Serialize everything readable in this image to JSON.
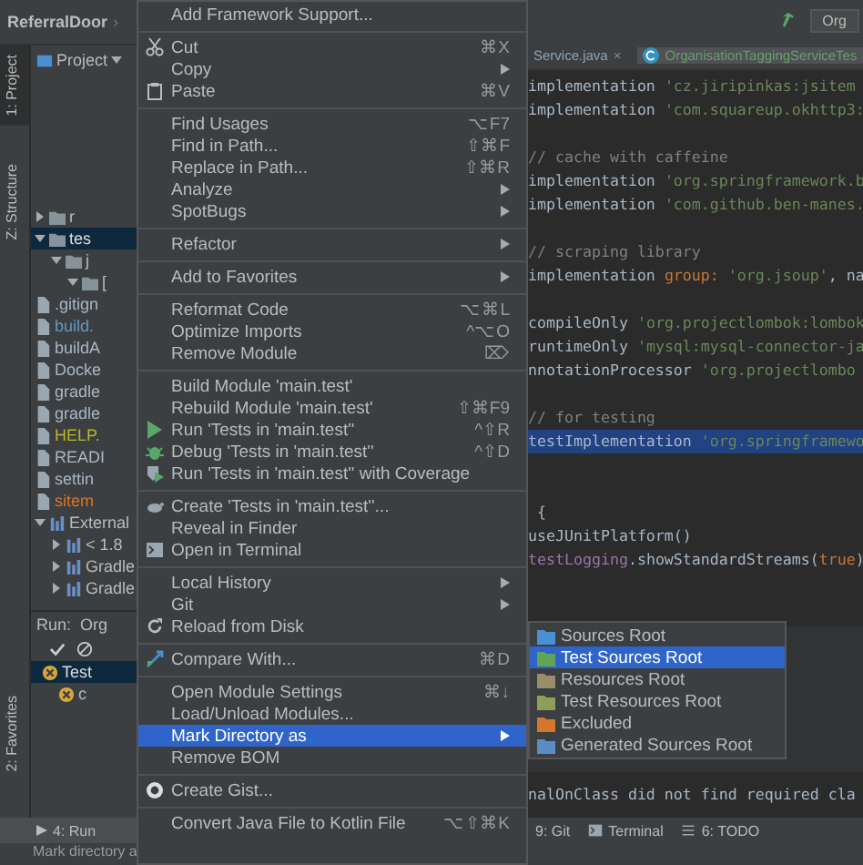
{
  "breadcrumb": {
    "project": "ReferralDoor",
    "separator": "›"
  },
  "tool_strip": [
    {
      "label": "1: Project",
      "selected": true
    },
    {
      "label": "Z: Structure",
      "selected": false
    },
    {
      "label": "2: Favorites",
      "selected": false
    }
  ],
  "project_panel": {
    "title": "Project",
    "tree": [
      {
        "name": "r",
        "kind": "folder",
        "expanded": false,
        "selected": false
      },
      {
        "name": "tes",
        "kind": "folder",
        "expanded": true,
        "selected": true,
        "children": [
          {
            "name": "j",
            "kind": "folder",
            "expanded": true,
            "selected": false,
            "children": [
              {
                "name": "[",
                "kind": "folder",
                "expanded": true,
                "selected": false
              }
            ]
          }
        ]
      },
      {
        "name": ".gitign",
        "kind": "file",
        "selected": false,
        "color": "#a9b7c6"
      },
      {
        "name": "build.",
        "kind": "file",
        "selected": false,
        "color": "#6897bb"
      },
      {
        "name": "buildA",
        "kind": "file",
        "selected": false,
        "color": "#a9b7c6"
      },
      {
        "name": "Docke",
        "kind": "file",
        "selected": false,
        "color": "#a9b7c6"
      },
      {
        "name": "gradle",
        "kind": "file",
        "selected": false,
        "color": "#a9b7c6"
      },
      {
        "name": "gradle",
        "kind": "file",
        "selected": false,
        "color": "#a9b7c6"
      },
      {
        "name": "HELP.",
        "kind": "file",
        "selected": false,
        "color": "#bbb529"
      },
      {
        "name": "READI",
        "kind": "file",
        "selected": false,
        "color": "#a9b7c6"
      },
      {
        "name": "settin",
        "kind": "file",
        "selected": false,
        "color": "#a9b7c6"
      },
      {
        "name": "sitem",
        "kind": "file",
        "selected": false,
        "color": "#d5762c"
      },
      {
        "name": "External",
        "kind": "library",
        "expanded": true,
        "selected": false,
        "children": [
          {
            "name": "< 1.8",
            "kind": "library",
            "expanded": false,
            "selected": false
          },
          {
            "name": "Gradle",
            "kind": "library",
            "expanded": false,
            "selected": false
          },
          {
            "name": "Gradle",
            "kind": "library",
            "expanded": false,
            "selected": false
          }
        ]
      }
    ]
  },
  "run_panel": {
    "label": "Run:",
    "tab": "Org",
    "tree": [
      {
        "name": "Test",
        "selected": true,
        "children": [
          {
            "name": "c",
            "selected": false
          }
        ]
      }
    ]
  },
  "bottom_left": {
    "run_tab": "4: Run",
    "status": "Mark directory a"
  },
  "context_menu": [
    [
      {
        "label": "Add Framework Support...",
        "submenu": false,
        "selected": false
      }
    ],
    [
      {
        "label": "Cut",
        "shortcut": "⌘X",
        "submenu": false,
        "selected": false
      },
      {
        "label": "Copy",
        "submenu": true,
        "selected": false
      },
      {
        "label": "Paste",
        "shortcut": "⌘V",
        "submenu": false,
        "selected": false
      }
    ],
    [
      {
        "label": "Find Usages",
        "shortcut": "⌥F7",
        "submenu": false,
        "selected": false
      },
      {
        "label": "Find in Path...",
        "shortcut": "⇧⌘F",
        "submenu": false,
        "selected": false
      },
      {
        "label": "Replace in Path...",
        "shortcut": "⇧⌘R",
        "submenu": false,
        "selected": false
      },
      {
        "label": "Analyze",
        "submenu": true,
        "selected": false
      },
      {
        "label": "SpotBugs",
        "submenu": true,
        "selected": false
      }
    ],
    [
      {
        "label": "Refactor",
        "submenu": true,
        "selected": false
      }
    ],
    [
      {
        "label": "Add to Favorites",
        "submenu": true,
        "selected": false
      }
    ],
    [
      {
        "label": "Reformat Code",
        "shortcut": "⌥⌘L",
        "submenu": false,
        "selected": false
      },
      {
        "label": "Optimize Imports",
        "shortcut": "^⌥O",
        "submenu": false,
        "selected": false
      },
      {
        "label": "Remove Module",
        "shortcut": "⌦",
        "submenu": false,
        "selected": false
      }
    ],
    [
      {
        "label": "Build Module 'main.test'",
        "submenu": false,
        "selected": false
      },
      {
        "label": "Rebuild Module 'main.test'",
        "shortcut": "⇧⌘F9",
        "submenu": false,
        "selected": false
      },
      {
        "label": "Run 'Tests in 'main.test''",
        "shortcut": "^⇧R",
        "submenu": false,
        "selected": false
      },
      {
        "label": "Debug 'Tests in 'main.test''",
        "shortcut": "^⇧D",
        "submenu": false,
        "selected": false
      },
      {
        "label": "Run 'Tests in 'main.test'' with Coverage",
        "submenu": false,
        "selected": false
      }
    ],
    [
      {
        "label": "Create 'Tests in 'main.test''...",
        "submenu": false,
        "selected": false
      },
      {
        "label": "Reveal in Finder",
        "submenu": false,
        "selected": false
      },
      {
        "label": "Open in Terminal",
        "submenu": false,
        "selected": false
      }
    ],
    [
      {
        "label": "Local History",
        "submenu": true,
        "selected": false
      },
      {
        "label": "Git",
        "submenu": true,
        "selected": false
      },
      {
        "label": "Reload from Disk",
        "submenu": false,
        "selected": false
      }
    ],
    [
      {
        "label": "Compare With...",
        "shortcut": "⌘D",
        "submenu": false,
        "selected": false
      }
    ],
    [
      {
        "label": "Open Module Settings",
        "shortcut": "⌘↓",
        "submenu": false,
        "selected": false
      },
      {
        "label": "Load/Unload Modules...",
        "submenu": false,
        "selected": false
      },
      {
        "label": "Mark Directory as",
        "submenu": true,
        "selected": true
      },
      {
        "label": "Remove BOM",
        "submenu": false,
        "selected": false
      }
    ],
    [
      {
        "label": "Create Gist...",
        "submenu": false,
        "selected": false
      }
    ],
    [
      {
        "label": "Convert Java File to Kotlin File",
        "shortcut": "⌥⇧⌘K",
        "submenu": false,
        "selected": false
      }
    ]
  ],
  "toolbar": {
    "run_config": "Org"
  },
  "editor_tabs": [
    {
      "label": "Service.java",
      "close": "×",
      "selected": false
    },
    {
      "label": "OrganisationTaggingServiceTes",
      "selected": true
    }
  ],
  "code_lines": [
    {
      "selected": false,
      "tokens": [
        {
          "text": "implementation ",
          "kind": "plain"
        },
        {
          "text": "'cz.jiripinkas:jsitem",
          "kind": "string"
        }
      ]
    },
    {
      "selected": false,
      "tokens": [
        {
          "text": "implementation ",
          "kind": "plain"
        },
        {
          "text": "'com.squareup.okhttp3:",
          "kind": "string"
        }
      ]
    },
    {
      "kind": "blank"
    },
    {
      "selected": false,
      "tokens": [
        {
          "text": "// cache with caffeine",
          "kind": "comment"
        }
      ]
    },
    {
      "selected": false,
      "tokens": [
        {
          "text": "implementation ",
          "kind": "plain"
        },
        {
          "text": "'org.springframework.b",
          "kind": "string"
        }
      ]
    },
    {
      "selected": false,
      "tokens": [
        {
          "text": "implementation ",
          "kind": "plain"
        },
        {
          "text": "'com.github.ben-manes.",
          "kind": "string"
        }
      ]
    },
    {
      "kind": "blank"
    },
    {
      "selected": false,
      "tokens": [
        {
          "text": "// scraping library",
          "kind": "comment"
        }
      ]
    },
    {
      "selected": false,
      "tokens": [
        {
          "text": "implementation ",
          "kind": "plain"
        },
        {
          "text": "group: ",
          "kind": "keyword"
        },
        {
          "text": "'org.jsoup'",
          "kind": "string"
        },
        {
          "text": ", na",
          "kind": "plain"
        }
      ]
    },
    {
      "kind": "blank"
    },
    {
      "selected": false,
      "tokens": [
        {
          "text": "compileOnly ",
          "kind": "plain"
        },
        {
          "text": "'org.projectlombok:lombok",
          "kind": "string"
        }
      ]
    },
    {
      "selected": false,
      "tokens": [
        {
          "text": "runtimeOnly ",
          "kind": "plain"
        },
        {
          "text": "'mysql:mysql-connector-ja",
          "kind": "string"
        }
      ]
    },
    {
      "selected": false,
      "tokens": [
        {
          "text": "nnotationProcessor ",
          "kind": "plain"
        },
        {
          "text": "'org.projectlombo",
          "kind": "string"
        }
      ]
    },
    {
      "kind": "blank"
    },
    {
      "selected": false,
      "tokens": [
        {
          "text": "// for testing",
          "kind": "comment"
        }
      ]
    },
    {
      "selected": true,
      "tokens": [
        {
          "text": "testImplementation ",
          "kind": "plain"
        },
        {
          "text": "'org.springframewo",
          "kind": "string"
        }
      ]
    },
    {
      "kind": "blank"
    },
    {
      "kind": "blank"
    },
    {
      "selected": false,
      "tokens": [
        {
          "text": " {",
          "kind": "plain"
        }
      ]
    },
    {
      "selected": false,
      "tokens": [
        {
          "text": "useJUnitPlatform()",
          "kind": "plain"
        }
      ]
    },
    {
      "selected": false,
      "tokens": [
        {
          "text": "testLogging",
          "kind": "field"
        },
        {
          "text": ".showStandardStreams(",
          "kind": "plain"
        },
        {
          "text": "true",
          "kind": "keyword"
        },
        {
          "text": ")",
          "kind": "plain"
        }
      ]
    }
  ],
  "console_line": "nalOnClass did not find required cla",
  "submenu": [
    {
      "label": "Sources Root",
      "color": "#4a8fcf",
      "selected": false
    },
    {
      "label": "Test Sources Root",
      "color": "#62a35a",
      "selected": true
    },
    {
      "label": "Resources Root",
      "color": "#9b8c6a",
      "selected": false
    },
    {
      "label": "Test Resources Root",
      "color": "#8e9e5a",
      "selected": false
    },
    {
      "label": "Excluded",
      "color": "#d5762c",
      "selected": false
    },
    {
      "label": "Generated Sources Root",
      "color": "#5b8cc4",
      "selected": false
    }
  ],
  "status_tabs": [
    {
      "label": "9: Git",
      "kind": "git"
    },
    {
      "label": "Terminal",
      "kind": "terminal"
    },
    {
      "label": "6: TODO",
      "kind": "todo"
    }
  ]
}
